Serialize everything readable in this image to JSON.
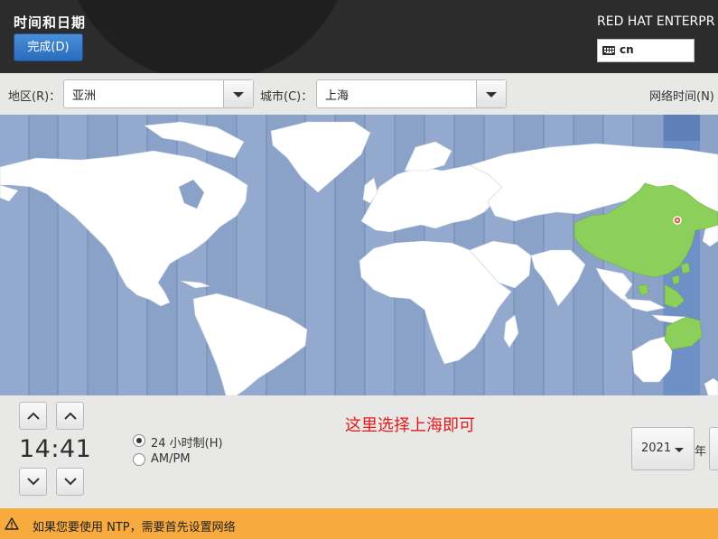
{
  "header": {
    "title": "时间和日期",
    "done_label": "完成(D)",
    "product": "RED HAT ENTERPR",
    "keyboard_layout": "cn"
  },
  "selector": {
    "region_label": "地区(R)：",
    "region_value": "亚洲",
    "city_label": "城市(C)：",
    "city_value": "上海",
    "network_time_label": "网络时间(N)"
  },
  "map": {
    "ocean_color": "#8aa1c8",
    "land_color": "#ffffff",
    "selected_zone_color": "#6f8fc7",
    "selected_country_color": "#8ccf5a",
    "marker_color": "#e04b3c"
  },
  "time": {
    "value": "14:41",
    "format_24h_label": "24 小时制(H)",
    "format_ampm_label": "AM/PM",
    "selected_format": "24h"
  },
  "annotation": "这里选择上海即可",
  "date": {
    "year": "2021",
    "year_unit": "年"
  },
  "warning": {
    "icon": "warning-icon",
    "text": "如果您要使用 NTP，需要首先设置网络"
  }
}
